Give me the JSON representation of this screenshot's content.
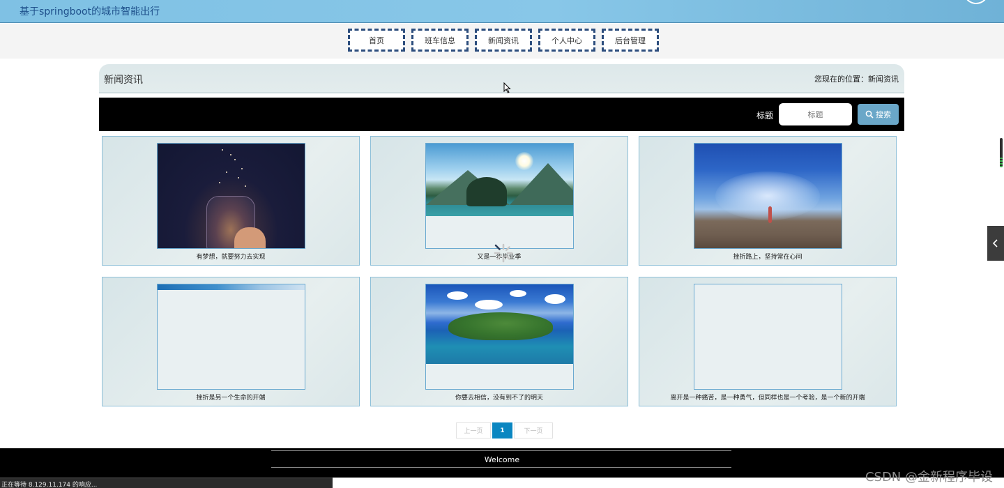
{
  "header": {
    "title": "基于springboot的城市智能出行"
  },
  "nav": {
    "items": [
      {
        "label": "首页"
      },
      {
        "label": "班车信息"
      },
      {
        "label": "新闻资讯"
      },
      {
        "label": "个人中心"
      },
      {
        "label": "后台管理"
      }
    ]
  },
  "breadcrumb": {
    "title": "新闻资讯",
    "location_prefix": "您现在的位置：",
    "location": "新闻资讯"
  },
  "search": {
    "label": "标题",
    "placeholder": "标题",
    "button_label": "搜索"
  },
  "news": [
    {
      "caption": "有梦想，就要努力去实现",
      "image": "starry-jar-photo"
    },
    {
      "caption": "又是一年毕业季",
      "image": "mountain-lake-photo"
    },
    {
      "caption": "挫折路上，坚持常在心间",
      "image": "beach-girl-photo"
    },
    {
      "caption": "挫折是另一个生命的开端",
      "image": "blue-strip-photo"
    },
    {
      "caption": "你要去相信，没有到不了的明天",
      "image": "island-photo"
    },
    {
      "caption": "离开是一种痛苦，是一种勇气，但同样也是一个考验，是一个新的开端",
      "image": "empty"
    }
  ],
  "pagination": {
    "prev_label": "上一页",
    "current": "1",
    "next_label": "下一页"
  },
  "footer": {
    "text": "Welcome"
  },
  "browser_status": {
    "text": "正在等待 8.129.11.174 的响应..."
  },
  "watermark": {
    "text": "CSDN @金新程序毕设"
  },
  "colors": {
    "header_bg": "#88c7e8",
    "nav_border": "#2c4d7d",
    "search_button": "#6aa7c8",
    "pager_active": "#0a86c1",
    "footer_bg": "#000000"
  }
}
